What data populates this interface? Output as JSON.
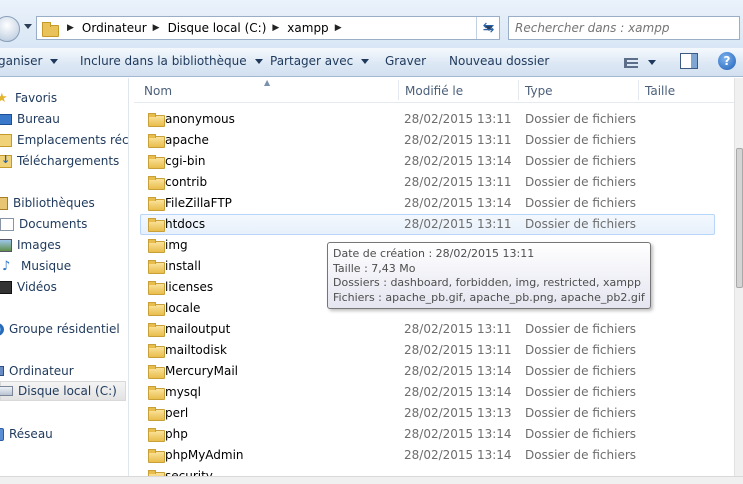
{
  "address": {
    "folder_icon": "folder-icon",
    "breadcrumb": [
      "Ordinateur",
      "Disque local (C:)",
      "xampp"
    ],
    "search_placeholder": "Rechercher dans : xampp"
  },
  "toolbar": {
    "organize": "ganiser",
    "include_library": "Inclure dans la bibliothèque",
    "share_with": "Partager avec",
    "burn": "Graver",
    "new_folder": "Nouveau dossier",
    "help": "?"
  },
  "nav": {
    "favorites": "Favoris",
    "desktop": "Bureau",
    "recent_places": "Emplacements récer",
    "downloads": "Téléchargements",
    "libraries": "Bibliothèques",
    "documents": "Documents",
    "images": "Images",
    "music": "Musique",
    "videos": "Vidéos",
    "homegroup": "Groupe résidentiel",
    "computer": "Ordinateur",
    "local_disk": "Disque local (C:)",
    "network": "Réseau"
  },
  "columns": {
    "name": "Nom",
    "modified": "Modifié le",
    "type": "Type",
    "size": "Taille"
  },
  "files": [
    {
      "name": "anonymous",
      "date": "28/02/2015 13:11",
      "type": "Dossier de fichiers"
    },
    {
      "name": "apache",
      "date": "28/02/2015 13:11",
      "type": "Dossier de fichiers"
    },
    {
      "name": "cgi-bin",
      "date": "28/02/2015 13:14",
      "type": "Dossier de fichiers"
    },
    {
      "name": "contrib",
      "date": "28/02/2015 13:11",
      "type": "Dossier de fichiers"
    },
    {
      "name": "FileZillaFTP",
      "date": "28/02/2015 13:14",
      "type": "Dossier de fichiers"
    },
    {
      "name": "htdocs",
      "date": "28/02/2015 13:11",
      "type": "Dossier de fichiers"
    },
    {
      "name": "img",
      "date": "",
      "type": ""
    },
    {
      "name": "install",
      "date": "",
      "type": ""
    },
    {
      "name": "licenses",
      "date": "",
      "type": ""
    },
    {
      "name": "locale",
      "date": "",
      "type": ""
    },
    {
      "name": "mailoutput",
      "date": "28/02/2015 13:11",
      "type": "Dossier de fichiers"
    },
    {
      "name": "mailtodisk",
      "date": "28/02/2015 13:11",
      "type": "Dossier de fichiers"
    },
    {
      "name": "MercuryMail",
      "date": "28/02/2015 13:14",
      "type": "Dossier de fichiers"
    },
    {
      "name": "mysql",
      "date": "28/02/2015 13:14",
      "type": "Dossier de fichiers"
    },
    {
      "name": "perl",
      "date": "28/02/2015 13:13",
      "type": "Dossier de fichiers"
    },
    {
      "name": "php",
      "date": "28/02/2015 13:14",
      "type": "Dossier de fichiers"
    },
    {
      "name": "phpMyAdmin",
      "date": "28/02/2015 13:14",
      "type": "Dossier de fichiers"
    },
    {
      "name": "security",
      "date": "",
      "type": ""
    }
  ],
  "tooltip": {
    "created": "Date de création : 28/02/2015 13:11",
    "size": "Taille : 7,43 Mo",
    "folders": "Dossiers : dashboard, forbidden, img, restricted, xampp",
    "files": "Fichiers : apache_pb.gif, apache_pb.png, apache_pb2.gif, ..."
  }
}
